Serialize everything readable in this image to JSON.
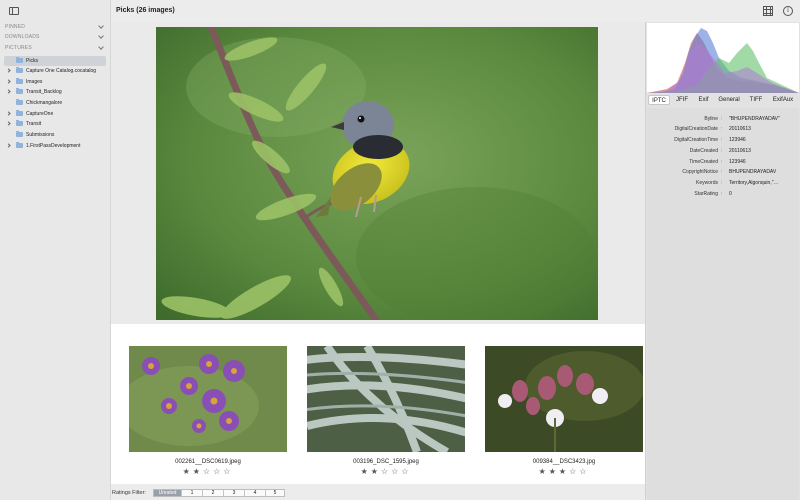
{
  "sidebar": {
    "sections": [
      {
        "label": "PINNED"
      },
      {
        "label": "DOWNLOADS"
      },
      {
        "label": "PICTURES"
      }
    ],
    "items": [
      {
        "label": "Picks",
        "has_children": false,
        "selected": true
      },
      {
        "label": "Capture One Catalog.cocatalog",
        "has_children": true,
        "selected": false
      },
      {
        "label": "Images",
        "has_children": true,
        "selected": false
      },
      {
        "label": "Transit_Backlog",
        "has_children": true,
        "selected": false
      },
      {
        "label": "Chickmangalore",
        "has_children": false,
        "selected": false
      },
      {
        "label": "CaptureOne",
        "has_children": true,
        "selected": false
      },
      {
        "label": "Transit",
        "has_children": true,
        "selected": false
      },
      {
        "label": "Submissions",
        "has_children": false,
        "selected": false
      },
      {
        "label": "1.FirstPassDevelopment",
        "has_children": true,
        "selected": false
      }
    ]
  },
  "main": {
    "title": "Picks (26 images)"
  },
  "thumbnails": [
    {
      "filename": "002261__DSC0619.jpeg",
      "stars": "★★☆☆☆"
    },
    {
      "filename": "003196_DSC_1595.jpeg",
      "stars": "★★☆☆☆"
    },
    {
      "filename": "009384__DSC3423.jpg",
      "stars": "★★★☆☆"
    }
  ],
  "ratings": {
    "label": "Ratings Filter:",
    "options": [
      "Unrated",
      "1",
      "2",
      "3",
      "4",
      "5"
    ],
    "active": "Unrated"
  },
  "metadata_tabs": [
    "IPTC",
    "JFIF",
    "Exif",
    "General",
    "TIFF",
    "ExifAux"
  ],
  "metadata_active_tab": "IPTC",
  "metadata": [
    {
      "key": "Byline",
      "value": "\"BHUPENDRAYADAV\""
    },
    {
      "key": "DigitalCreationDate",
      "value": "20110613"
    },
    {
      "key": "DigitalCreationTime",
      "value": "123946"
    },
    {
      "key": "DateCreated",
      "value": "20110613"
    },
    {
      "key": "TimeCreated",
      "value": "123946"
    },
    {
      "key": "CopyrightNotice",
      "value": "BHUPENDRAYADAV"
    },
    {
      "key": "Keywords",
      "value": "Territory,Algonquin,\"…"
    },
    {
      "key": "StarRating",
      "value": "0"
    }
  ],
  "colors": {
    "selection": "#cfd3d8",
    "folder": "#8fb3dc",
    "active_rating": "#9aa0a8"
  }
}
